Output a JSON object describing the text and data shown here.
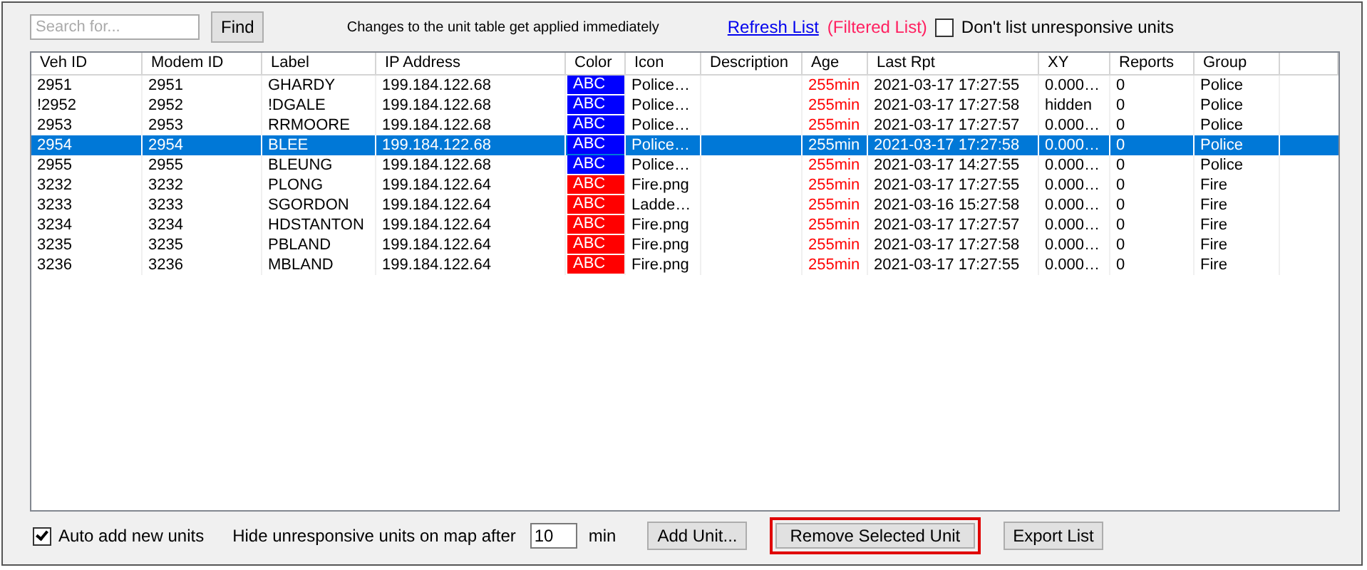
{
  "toolbar": {
    "search": {
      "placeholder": "Search for..."
    },
    "find_button": "Find",
    "notice": "Changes to the unit table get applied immediately",
    "refresh_link": "Refresh List",
    "filter_status": "(Filtered List)",
    "hide_unresponsive": {
      "label": "Don't list unresponsive units",
      "checked": false
    }
  },
  "table": {
    "columns": [
      "Veh ID",
      "Modem ID",
      "Label",
      "IP Address",
      "Color",
      "Icon",
      "Description",
      "Age",
      "Last Rpt",
      "XY",
      "Reports",
      "Group"
    ],
    "rows": [
      {
        "selected": false,
        "color": "#0000ff",
        "cells": [
          "2951",
          "2951",
          "GHARDY",
          "199.184.122.68",
          "ABC",
          "Police…",
          "",
          "255min",
          "2021-03-17 17:27:55",
          "0.000…",
          "0",
          "Police"
        ]
      },
      {
        "selected": false,
        "color": "#0000ff",
        "cells": [
          "!2952",
          "2952",
          "!DGALE",
          "199.184.122.68",
          "ABC",
          "Police…",
          "",
          "255min",
          "2021-03-17 17:27:58",
          "hidden",
          "0",
          "Police"
        ]
      },
      {
        "selected": false,
        "color": "#0000ff",
        "cells": [
          "2953",
          "2953",
          "RRMOORE",
          "199.184.122.68",
          "ABC",
          "Police…",
          "",
          "255min",
          "2021-03-17 17:27:57",
          "0.000…",
          "0",
          "Police"
        ]
      },
      {
        "selected": true,
        "color": "#0000ff",
        "cells": [
          "2954",
          "2954",
          "BLEE",
          "199.184.122.68",
          "ABC",
          "Police…",
          "",
          "255min",
          "2021-03-17 17:27:58",
          "0.000…",
          "0",
          "Police"
        ]
      },
      {
        "selected": false,
        "color": "#0000ff",
        "cells": [
          "2955",
          "2955",
          "BLEUNG",
          "199.184.122.68",
          "ABC",
          "Police…",
          "",
          "255min",
          "2021-03-17 14:27:55",
          "0.000…",
          "0",
          "Police"
        ]
      },
      {
        "selected": false,
        "color": "#ff0000",
        "cells": [
          "3232",
          "3232",
          "PLONG",
          "199.184.122.64",
          "ABC",
          "Fire.png",
          "",
          "255min",
          "2021-03-17 17:27:55",
          "0.000…",
          "0",
          "Fire"
        ]
      },
      {
        "selected": false,
        "color": "#ff0000",
        "cells": [
          "3233",
          "3233",
          "SGORDON",
          "199.184.122.64",
          "ABC",
          "Ladde…",
          "",
          "255min",
          "2021-03-16 15:27:58",
          "0.000…",
          "0",
          "Fire"
        ]
      },
      {
        "selected": false,
        "color": "#ff0000",
        "cells": [
          "3234",
          "3234",
          "HDSTANTON",
          "199.184.122.64",
          "ABC",
          "Fire.png",
          "",
          "255min",
          "2021-03-17 17:27:57",
          "0.000…",
          "0",
          "Fire"
        ]
      },
      {
        "selected": false,
        "color": "#ff0000",
        "cells": [
          "3235",
          "3235",
          "PBLAND",
          "199.184.122.64",
          "ABC",
          "Fire.png",
          "",
          "255min",
          "2021-03-17 17:27:58",
          "0.000…",
          "0",
          "Fire"
        ]
      },
      {
        "selected": false,
        "color": "#ff0000",
        "cells": [
          "3236",
          "3236",
          "MBLAND",
          "199.184.122.64",
          "ABC",
          "Fire.png",
          "",
          "255min",
          "2021-03-17 17:27:55",
          "0.000…",
          "0",
          "Fire"
        ]
      }
    ]
  },
  "footer": {
    "auto_add": {
      "label": "Auto add new units",
      "checked": true
    },
    "hide_label": "Hide unresponsive units on map after",
    "hide_minutes": "10",
    "minutes_unit": "min",
    "buttons": [
      {
        "label": "Add Unit...",
        "highlighted": false
      },
      {
        "label": "Remove Selected Unit",
        "highlighted": true
      },
      {
        "label": "Export List",
        "highlighted": false
      }
    ]
  }
}
